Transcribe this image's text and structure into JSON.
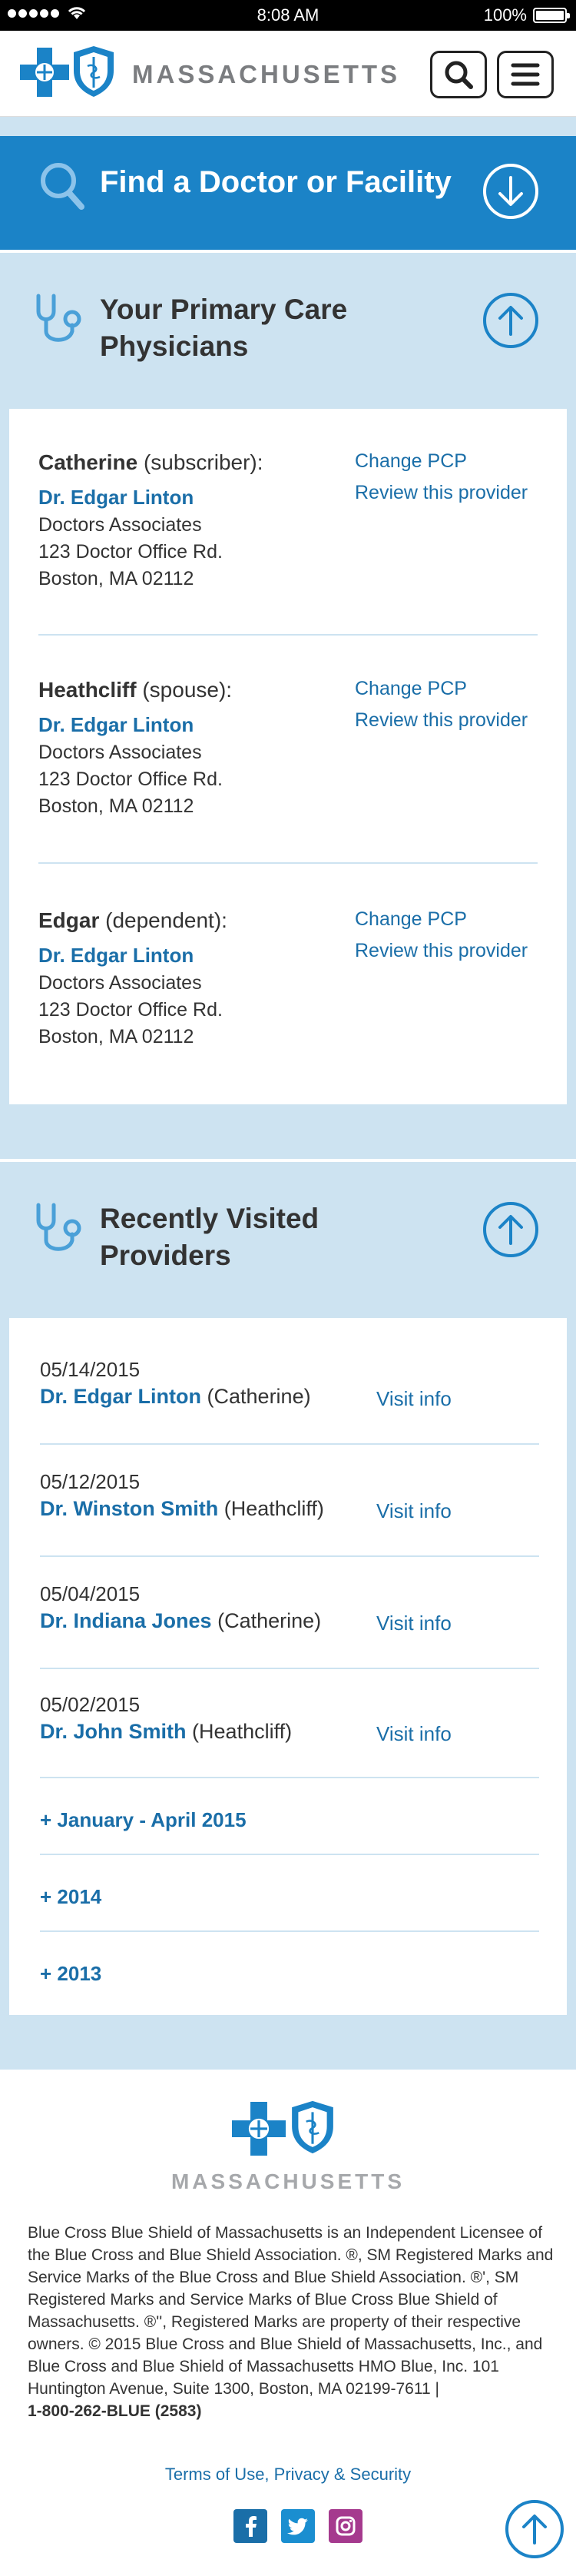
{
  "status_bar": {
    "time": "8:08 AM",
    "battery": "100%"
  },
  "header": {
    "brand": "MASSACHUSETTS"
  },
  "find": {
    "title": "Find a Doctor or Facility"
  },
  "pcp_section": {
    "title": "Your Primary Care Physicians",
    "members": [
      {
        "name": "Catherine",
        "role": "(subscriber):",
        "doctor": "Dr. Edgar Linton",
        "practice": "Doctors Associates",
        "street": "123 Doctor Office Rd.",
        "city": "Boston, MA 02112",
        "change": "Change PCP",
        "review": "Review this provider"
      },
      {
        "name": "Heathcliff",
        "role": "(spouse):",
        "doctor": "Dr. Edgar Linton",
        "practice": "Doctors Associates",
        "street": "123 Doctor Office Rd.",
        "city": "Boston, MA 02112",
        "change": "Change PCP",
        "review": "Review this provider"
      },
      {
        "name": "Edgar",
        "role": "(dependent):",
        "doctor": "Dr. Edgar Linton",
        "practice": "Doctors Associates",
        "street": "123 Doctor Office Rd.",
        "city": "Boston, MA 02112",
        "change": "Change PCP",
        "review": "Review this provider"
      }
    ]
  },
  "recent_section": {
    "title": "Recently Visited Providers",
    "visits": [
      {
        "date": "05/14/2015",
        "doctor": "Dr. Edgar Linton",
        "patient": "(Catherine)",
        "link": "Visit info"
      },
      {
        "date": "05/12/2015",
        "doctor": "Dr. Winston Smith",
        "patient": "(Heathcliff)",
        "link": "Visit info"
      },
      {
        "date": "05/04/2015",
        "doctor": "Dr. Indiana Jones",
        "patient": "(Catherine)",
        "link": "Visit info"
      },
      {
        "date": "05/02/2015",
        "doctor": "Dr. John Smith",
        "patient": "(Heathcliff)",
        "link": "Visit info"
      }
    ],
    "expanders": [
      "+  January - April 2015",
      "+  2014",
      "+  2013"
    ]
  },
  "footer": {
    "brand": "MASSACHUSETTS",
    "legal": "Blue Cross Blue Shield of Massachusetts is an Independent Licensee of the Blue Cross and Blue Shield Association. ®, SM Registered Marks and Service Marks of the Blue Cross and Blue Shield Association. ®', SM Registered Marks and Service Marks of Blue Cross Blue Shield of Massachusetts. ®'', Registered Marks are property of their respective owners. © 2015 Blue Cross and Blue Shield of Massachusetts, Inc., and Blue Cross and Blue Shield of Massachusetts HMO Blue, Inc. 101 Huntington Avenue, Suite 1300, Boston, MA 02199-7611 |",
    "phone": "1-800-262-BLUE (2583)",
    "terms": "Terms of Use, Privacy & Security"
  },
  "colors": {
    "brand_blue": "#1b83c7",
    "link_blue": "#1a6ea8",
    "section_bg": "#cde3f1"
  }
}
